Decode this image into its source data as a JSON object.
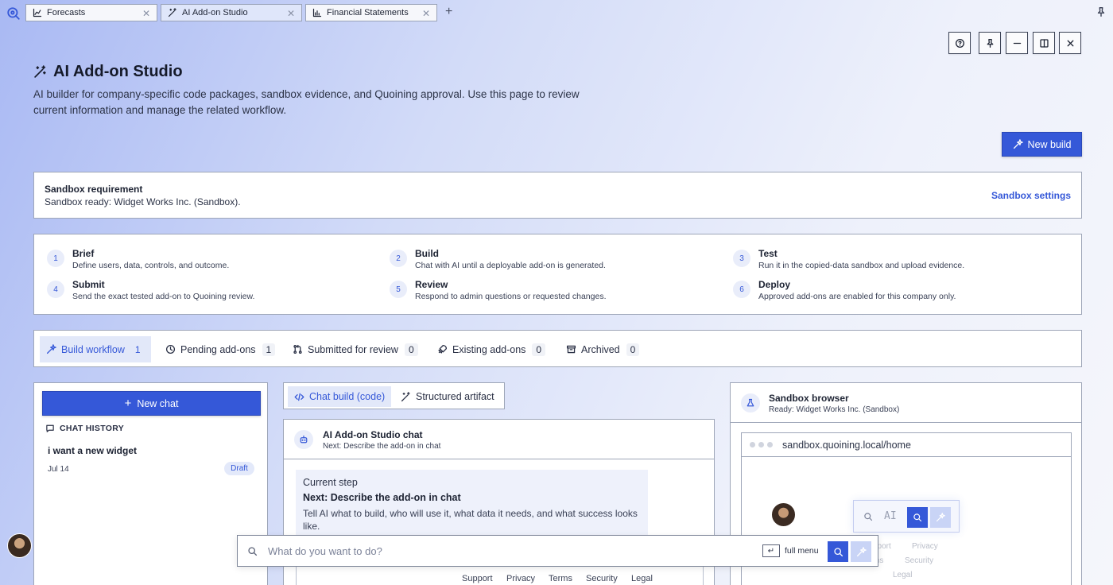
{
  "tabs": [
    {
      "label": "Forecasts",
      "icon": "line-chart-icon"
    },
    {
      "label": "AI Add-on Studio",
      "icon": "magic-wand-icon"
    },
    {
      "label": "Financial Statements",
      "icon": "bar-chart-icon"
    }
  ],
  "header": {
    "title": "AI Add-on Studio",
    "description": "AI builder for company-specific code packages, sandbox evidence, and Quoining approval. Use this page to review current information and manage the related workflow.",
    "new_build_label": "New build"
  },
  "sandbox_requirement": {
    "title": "Sandbox requirement",
    "status": "Sandbox ready: Widget Works Inc. (Sandbox).",
    "settings_link": "Sandbox settings"
  },
  "steps": [
    {
      "num": "1",
      "title": "Brief",
      "desc": "Define users, data, controls, and outcome."
    },
    {
      "num": "2",
      "title": "Build",
      "desc": "Chat with AI until a deployable add-on is generated."
    },
    {
      "num": "3",
      "title": "Test",
      "desc": "Run it in the copied-data sandbox and upload evidence."
    },
    {
      "num": "4",
      "title": "Submit",
      "desc": "Send the exact tested add-on to Quoining review."
    },
    {
      "num": "5",
      "title": "Review",
      "desc": "Respond to admin questions or requested changes."
    },
    {
      "num": "6",
      "title": "Deploy",
      "desc": "Approved add-ons are enabled for this company only."
    }
  ],
  "workflow_tabs": [
    {
      "label": "Build workflow",
      "count": "1"
    },
    {
      "label": "Pending add-ons",
      "count": "1"
    },
    {
      "label": "Submitted for review",
      "count": "0"
    },
    {
      "label": "Existing add-ons",
      "count": "0"
    },
    {
      "label": "Archived",
      "count": "0"
    }
  ],
  "left_panel": {
    "new_chat_label": "New chat",
    "history_heading": "CHAT HISTORY",
    "history": [
      {
        "title": "i want a new widget",
        "date": "Jul 14",
        "status": "Draft"
      }
    ]
  },
  "mode_tabs": [
    {
      "label": "Chat build (code)"
    },
    {
      "label": "Structured artifact"
    }
  ],
  "chat": {
    "title": "AI Add-on Studio chat",
    "subtitle": "Next: Describe the add-on in chat",
    "step_label": "Current step",
    "step_title": "Next: Describe the add-on in chat",
    "step_text": "Tell AI what to build, who will use it, what data it needs, and what success looks like."
  },
  "sandbox_browser": {
    "title": "Sandbox browser",
    "subtitle": "Ready: Widget Works Inc. (Sandbox)",
    "url": "sandbox.quoining.local/home",
    "mini_search_text": "AI",
    "ghost_links": [
      "pport",
      "Privacy",
      "ms",
      "Security",
      "Legal"
    ]
  },
  "command_bar": {
    "placeholder": "What do you want to do?",
    "kbd": "↵",
    "full_menu_label": "full menu"
  },
  "footer": {
    "links": [
      "Support",
      "Privacy",
      "Terms",
      "Security",
      "Legal"
    ]
  },
  "colors": {
    "accent": "#3558d8",
    "accent_light": "#e2e8f9",
    "border": "#9ea6b8"
  }
}
